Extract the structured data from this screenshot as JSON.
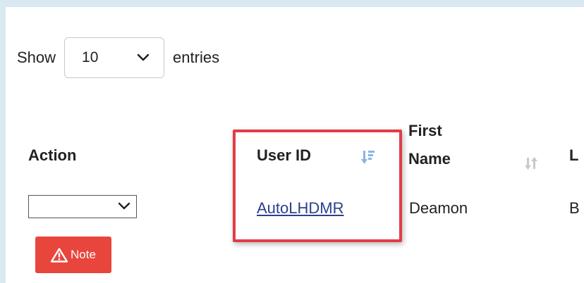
{
  "length_control": {
    "prefix": "Show",
    "selected": "10",
    "suffix": "entries"
  },
  "table": {
    "columns": [
      {
        "id": "action",
        "label": "Action"
      },
      {
        "id": "user_id",
        "label": "User ID",
        "sort": "descending"
      },
      {
        "id": "first_name",
        "label_line1": "First",
        "label_line2": "Name",
        "sort": "unsorted"
      },
      {
        "id": "last_name",
        "label": "L"
      }
    ],
    "rows": [
      {
        "action_selected": "",
        "note_label": "Note",
        "user_id": "AutoLHDMR",
        "first_name": "Deamon",
        "last_name": "B"
      }
    ]
  },
  "colors": {
    "page_background": "#d9e9f1",
    "link": "#2a3f8f",
    "note_button": "#e8453c",
    "highlight_border": "#e23d45",
    "sort_active": "#8ab4e6",
    "sort_inactive": "#c8c8c8"
  },
  "icons": {
    "length_dropdown": "chevron-down-icon",
    "action_dropdown": "chevron-down-icon",
    "note": "warning-triangle-icon",
    "user_id_sort": "sort-descending-icon",
    "first_name_sort": "sort-unsorted-icon"
  }
}
